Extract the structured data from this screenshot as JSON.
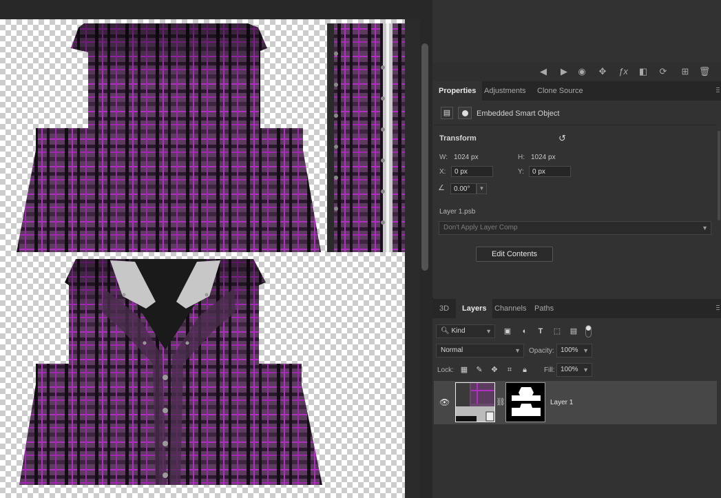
{
  "colors": {
    "panel_bg": "#323232",
    "tab_bar_bg": "#262626",
    "selected_row": "#474747",
    "plaid_base": "#5a3a5c",
    "plaid_magenta": "#b02bc0"
  },
  "toolbar": {
    "icons": [
      "step-back-icon",
      "step-forward-icon",
      "visibility-icon",
      "move-arrows-icon",
      "fx-icon",
      "mask-icon",
      "refresh-icon",
      "new-layer-icon",
      "trash-icon"
    ]
  },
  "properties_panel": {
    "tabs": [
      "Properties",
      "Adjustments",
      "Clone Source"
    ],
    "object_type": "Embedded Smart Object",
    "transform_title": "Transform",
    "w_label": "W:",
    "w_value": "1024 px",
    "h_label": "H:",
    "h_value": "1024 px",
    "x_label": "X:",
    "x_value": "0 px",
    "y_label": "Y:",
    "y_value": "0 px",
    "angle_value": "0.00°",
    "file_name": "Layer 1.psb",
    "layer_comp": "Don't Apply Layer Comp",
    "edit_button": "Edit Contents"
  },
  "layers_panel": {
    "tabs": [
      "3D",
      "Layers",
      "Channels",
      "Paths"
    ],
    "filter_kind": "Kind",
    "blend_mode": "Normal",
    "opacity_label": "Opacity:",
    "opacity_value": "100%",
    "lock_label": "Lock:",
    "fill_label": "Fill:",
    "fill_value": "100%",
    "layers": [
      {
        "name": "Layer 1",
        "visible": true,
        "selected": true
      }
    ]
  }
}
